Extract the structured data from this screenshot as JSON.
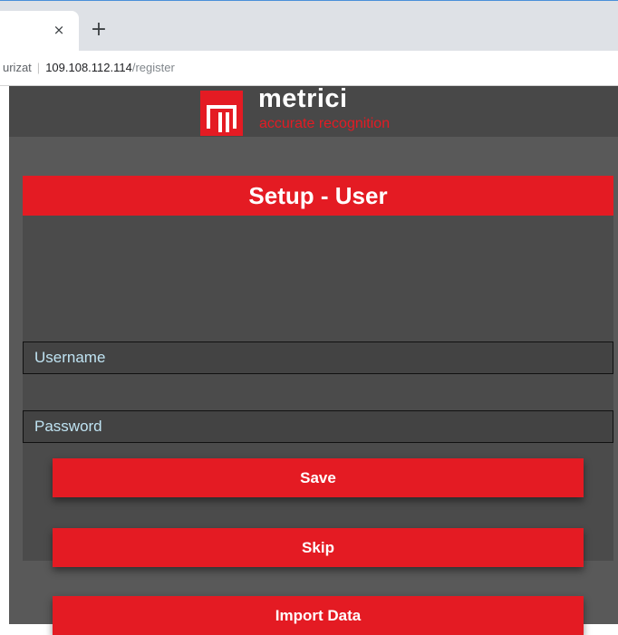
{
  "browser": {
    "tab": {
      "close_symbol": "×"
    },
    "new_tab_symbol": "+",
    "address": {
      "prefix": "urizat",
      "separator": "|",
      "host": "109.108.112.114",
      "path": "/register"
    }
  },
  "header": {
    "logo_icon": "metrici-m-logo",
    "brand_name": "metrici",
    "tagline": "accurate recognition"
  },
  "panel": {
    "title": "Setup - User",
    "username_placeholder": "Username",
    "password_placeholder": "Password",
    "buttons": {
      "save": "Save",
      "skip": "Skip",
      "import": "Import Data"
    }
  },
  "colors": {
    "accent_red": "#e41b23",
    "page_background": "#595959",
    "header_background": "#484848",
    "panel_background": "#4b4b4b"
  }
}
